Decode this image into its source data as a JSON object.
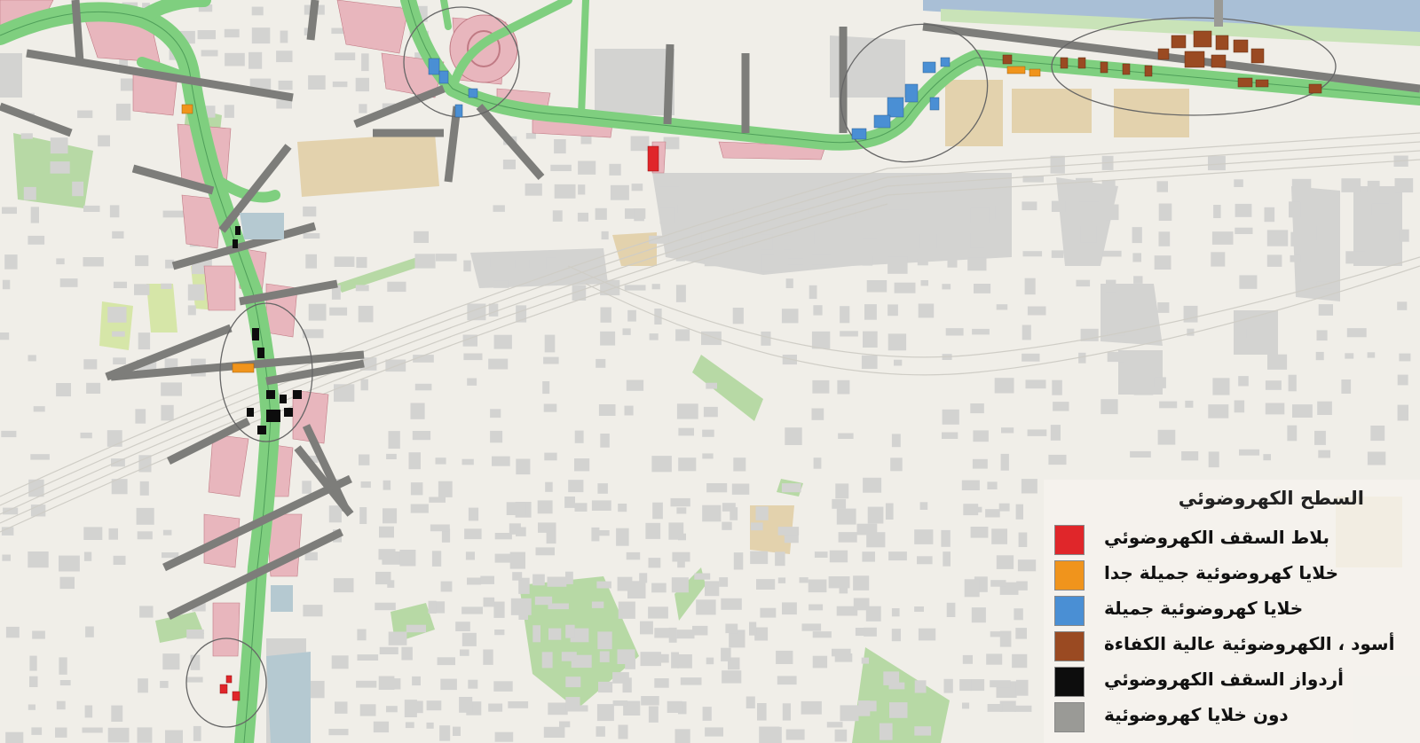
{
  "legend": {
    "title": "السطح الكهروضوئي",
    "items": [
      {
        "label": "بلاط السقف الكهروضوئي",
        "color": "#e0262a",
        "icon": "red-swatch-icon"
      },
      {
        "label": "خلايا كهروضوئية جميلة جدا",
        "color": "#f0941c",
        "icon": "orange-swatch-icon"
      },
      {
        "label": "خلايا كهروضوئية جميلة",
        "color": "#4a8fd4",
        "icon": "blue-swatch-icon"
      },
      {
        "label": "أسود ، الكهروضوئية عالية الكفاءة",
        "color": "#9a4a22",
        "icon": "brown-swatch-icon"
      },
      {
        "label": "أردواز السقف الكهروضوئي",
        "color": "#0d0d0d",
        "icon": "black-swatch-icon"
      },
      {
        "label": "دون خلايا كهروضوئية",
        "color": "#9a9a96",
        "icon": "gray-swatch-icon"
      }
    ]
  },
  "map_colors": {
    "background": "#f0eee8",
    "building": "#d3d3d1",
    "road": "#7fcf7f",
    "park": "#b7d9a5",
    "pink_building": "#e8b6bd",
    "sand": "#e3d2ad",
    "water": "#a9bfd6"
  }
}
